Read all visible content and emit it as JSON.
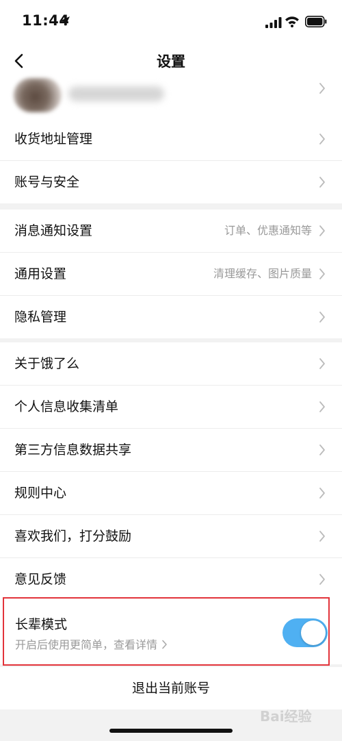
{
  "status_bar": {
    "time": "11:44"
  },
  "nav": {
    "title": "设置"
  },
  "groups": [
    {
      "rows": [
        {
          "label": "收货地址管理"
        },
        {
          "label": "账号与安全"
        }
      ]
    },
    {
      "rows": [
        {
          "label": "消息通知设置",
          "hint": "订单、优惠通知等"
        },
        {
          "label": "通用设置",
          "hint": "清理缓存、图片质量"
        },
        {
          "label": "隐私管理"
        }
      ]
    },
    {
      "rows": [
        {
          "label": "关于饿了么"
        },
        {
          "label": "个人信息收集清单"
        },
        {
          "label": "第三方信息数据共享"
        },
        {
          "label": "规则中心"
        },
        {
          "label": "喜欢我们，打分鼓励"
        },
        {
          "label": "意见反馈"
        }
      ]
    }
  ],
  "elder_mode": {
    "title": "长辈模式",
    "subtitle": "开启后使用更简单，查看详情",
    "enabled": true
  },
  "logout": {
    "label": "退出当前账号"
  },
  "watermark": "Bai经验"
}
